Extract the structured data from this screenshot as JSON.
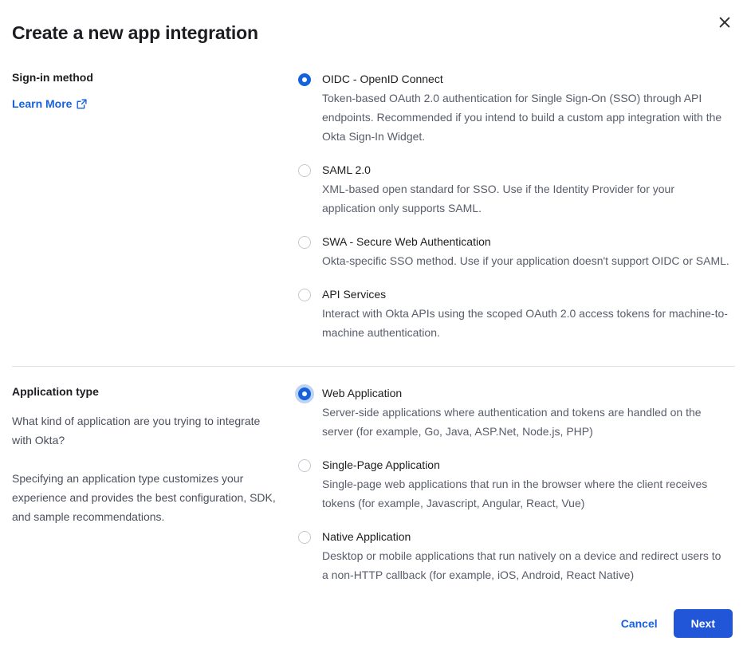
{
  "dialog": {
    "title": "Create a new app integration",
    "close_icon": "close-icon"
  },
  "signin_method": {
    "label": "Sign-in method",
    "learn_more_label": "Learn More",
    "learn_more_icon": "external-link-icon",
    "options": [
      {
        "title": "OIDC - OpenID Connect",
        "desc": "Token-based OAuth 2.0 authentication for Single Sign-On (SSO) through API endpoints. Recommended if you intend to build a custom app integration with the Okta Sign-In Widget.",
        "selected": true,
        "focused": false
      },
      {
        "title": "SAML 2.0",
        "desc": "XML-based open standard for SSO. Use if the Identity Provider for your application only supports SAML.",
        "selected": false,
        "focused": false
      },
      {
        "title": "SWA - Secure Web Authentication",
        "desc": "Okta-specific SSO method. Use if your application doesn't support OIDC or SAML.",
        "selected": false,
        "focused": false
      },
      {
        "title": "API Services",
        "desc": "Interact with Okta APIs using the scoped OAuth 2.0 access tokens for machine-to-machine authentication.",
        "selected": false,
        "focused": false
      }
    ]
  },
  "application_type": {
    "label": "Application type",
    "paragraphs": [
      "What kind of application are you trying to integrate with Okta?",
      "Specifying an application type customizes your experience and provides the best configuration, SDK, and sample recommendations."
    ],
    "options": [
      {
        "title": "Web Application",
        "desc": "Server-side applications where authentication and tokens are handled on the server (for example, Go, Java, ASP.Net, Node.js, PHP)",
        "selected": true,
        "focused": true
      },
      {
        "title": "Single-Page Application",
        "desc": "Single-page web applications that run in the browser where the client receives tokens (for example, Javascript, Angular, React, Vue)",
        "selected": false,
        "focused": false
      },
      {
        "title": "Native Application",
        "desc": "Desktop or mobile applications that run natively on a device and redirect users to a non-HTTP callback (for example, iOS, Android, React Native)",
        "selected": false,
        "focused": false
      }
    ]
  },
  "footer": {
    "cancel_label": "Cancel",
    "next_label": "Next"
  },
  "colors": {
    "accent": "#1662dc",
    "primary_button": "#2156d8",
    "text": "#1d1d21",
    "muted_text": "#595d6b",
    "divider": "#e1e3e8",
    "radio_border": "#c5c8cf"
  }
}
